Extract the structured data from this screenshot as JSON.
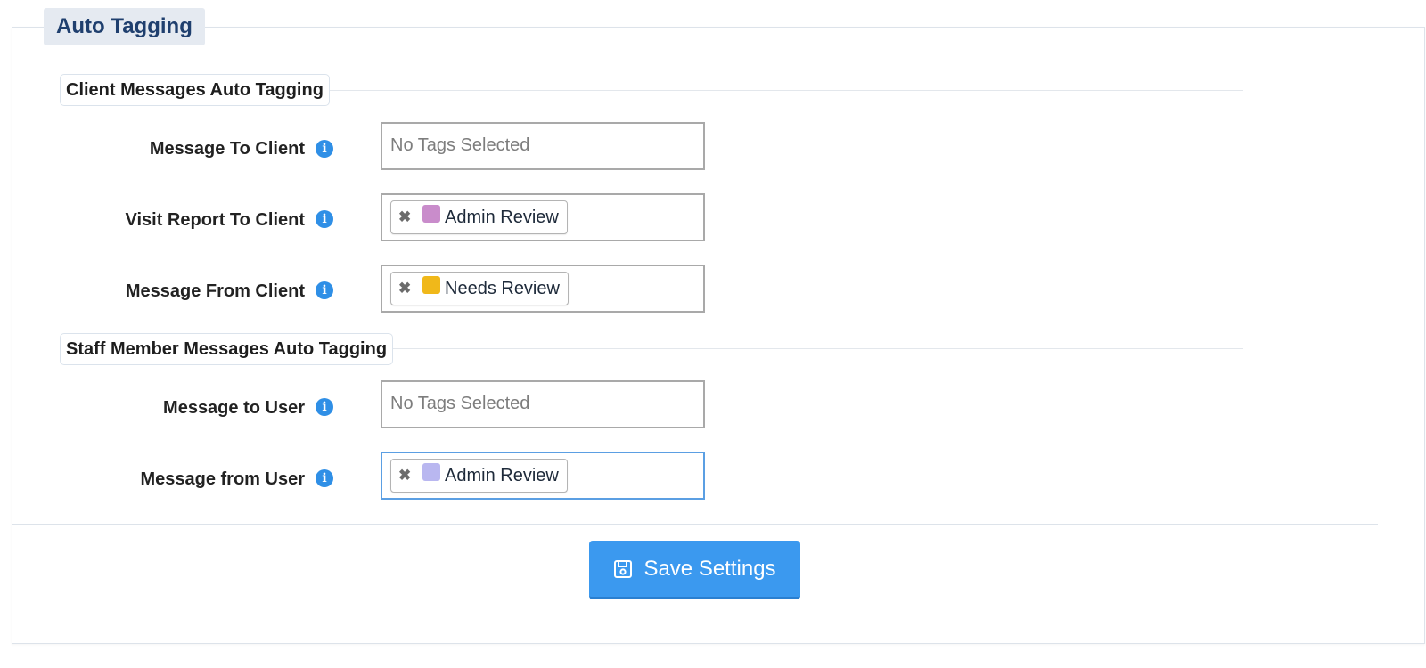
{
  "panel": {
    "title": "Auto Tagging"
  },
  "sections": [
    {
      "title": "Client Messages Auto Tagging"
    },
    {
      "title": "Staff Member Messages Auto Tagging"
    }
  ],
  "rows": [
    {
      "label": "Message To Client",
      "placeholder": "No Tags Selected",
      "tags": []
    },
    {
      "label": "Visit Report To Client",
      "tags": [
        {
          "label": "Admin Review",
          "color": "#c98ccb",
          "remove": "✖"
        }
      ]
    },
    {
      "label": "Message From Client",
      "tags": [
        {
          "label": "Needs Review",
          "color": "#f0b81a",
          "remove": "✖"
        }
      ]
    },
    {
      "label": "Message to User",
      "placeholder": "No Tags Selected",
      "tags": []
    },
    {
      "label": "Message from User",
      "tags": [
        {
          "label": "Admin Review",
          "color": "#b9b7f0",
          "remove": "✖"
        }
      ]
    }
  ],
  "info_icon": {
    "glyph": "i",
    "name": "info-icon",
    "color": "#2f8fe6"
  },
  "footer": {
    "save_label": "Save Settings",
    "save_icon": "floppy-disk-icon",
    "accent": "#3b99ef"
  }
}
